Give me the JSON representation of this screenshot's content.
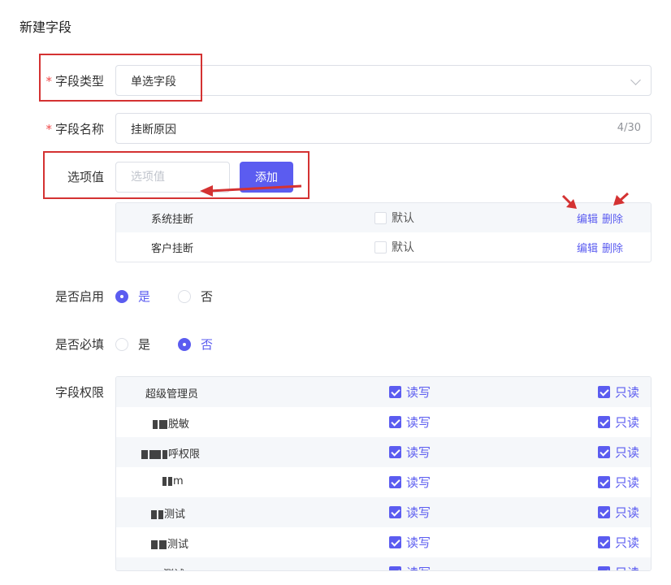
{
  "page": {
    "title": "新建字段"
  },
  "field_type": {
    "label": "字段类型",
    "required_mark": "*",
    "value": "单选字段"
  },
  "field_name": {
    "label": "字段名称",
    "required_mark": "*",
    "value": "挂断原因",
    "counter": "4/30"
  },
  "option_value": {
    "label": "选项值",
    "placeholder": "选项值",
    "add_label": "添加"
  },
  "options": [
    {
      "name": "系统挂断",
      "default_label": "默认",
      "edit_label": "编辑",
      "delete_label": "删除"
    },
    {
      "name": "客户挂断",
      "default_label": "默认",
      "edit_label": "编辑",
      "delete_label": "删除"
    }
  ],
  "enabled": {
    "label": "是否启用",
    "yes": "是",
    "no": "否",
    "selected": "yes"
  },
  "required": {
    "label": "是否必填",
    "yes": "是",
    "no": "否",
    "selected": "no"
  },
  "permissions": {
    "label": "字段权限",
    "rw_label": "读写",
    "ro_label": "只读",
    "roles": [
      {
        "name": "超级管理员"
      },
      {
        "name": "脱敏"
      },
      {
        "name": "呼权限"
      },
      {
        "name": "m"
      },
      {
        "name": "测试"
      },
      {
        "name": "测试"
      },
      {
        "name": "测试"
      }
    ]
  },
  "colors": {
    "accent": "#5b5cf0",
    "annotation": "#d43232",
    "required": "#f04a4a"
  }
}
